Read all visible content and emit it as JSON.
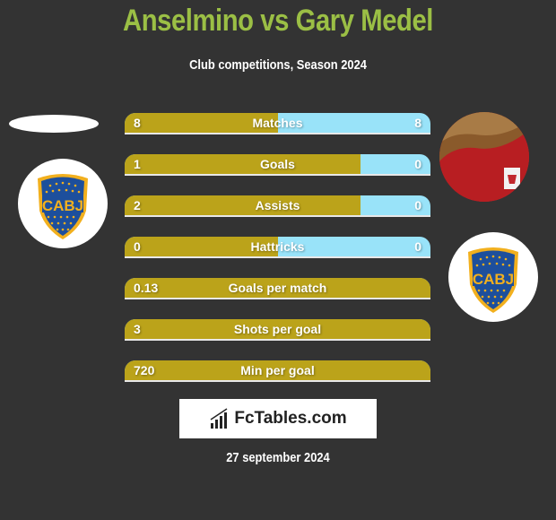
{
  "header": {
    "title": "Anselmino vs Gary Medel",
    "subtitle": "Club competitions, Season 2024"
  },
  "players": {
    "left": {
      "name": "Anselmino",
      "club_badge": "CABJ",
      "badge_icon": "boca-juniors-crest"
    },
    "right": {
      "name": "Gary Medel",
      "club_badge": "CABJ",
      "badge_icon": "boca-juniors-crest",
      "photo_icon": "player-photo"
    }
  },
  "colors": {
    "title": "#9bbf45",
    "left_bar": "#bba31a",
    "right_bar": "#99e3f9",
    "background": "#333333"
  },
  "stats": [
    {
      "label": "Matches",
      "left": "8",
      "right": "8",
      "left_share": 0.5
    },
    {
      "label": "Goals",
      "left": "1",
      "right": "0",
      "left_share": 0.77
    },
    {
      "label": "Assists",
      "left": "2",
      "right": "0",
      "left_share": 0.77
    },
    {
      "label": "Hattricks",
      "left": "0",
      "right": "0",
      "left_share": 0.5
    },
    {
      "label": "Goals per match",
      "left": "0.13",
      "right": "",
      "left_share": 1.0
    },
    {
      "label": "Shots per goal",
      "left": "3",
      "right": "",
      "left_share": 1.0
    },
    {
      "label": "Min per goal",
      "left": "720",
      "right": "",
      "left_share": 1.0
    }
  ],
  "footer": {
    "brand": "FcTables.com",
    "brand_icon": "bar-chart-icon",
    "date": "27 september 2024"
  }
}
